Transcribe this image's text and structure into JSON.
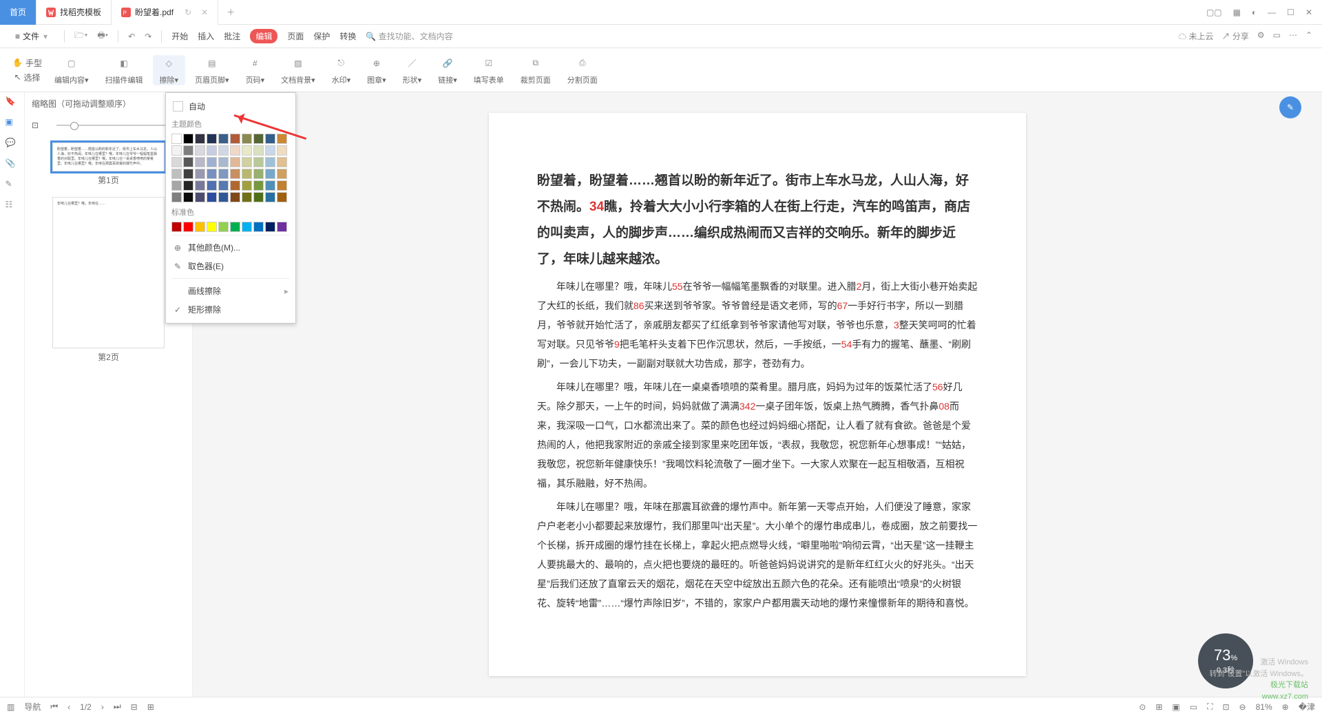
{
  "tabs": {
    "home": "首页",
    "t1": "找稻壳模板",
    "t2": "盼望着.pdf"
  },
  "file_label": "文件",
  "menu": {
    "start": "开始",
    "insert": "插入",
    "annotate": "批注",
    "edit": "编辑",
    "page": "页面",
    "protect": "保护",
    "convert": "转换",
    "search_ph": "查找功能、文档内容",
    "cloud": "未上云",
    "share": "分享"
  },
  "tools_left": {
    "hand": "手型",
    "select": "选择"
  },
  "ribbon": {
    "edit_content": "编辑内容",
    "scan": "扫描件编辑",
    "erase": "擦除",
    "header": "页眉页脚",
    "pagenum": "页码",
    "bg": "文档背景",
    "wm": "水印",
    "stamp": "图章",
    "shape": "形状",
    "link": "链接",
    "form": "填写表单",
    "crop": "裁剪页面",
    "split": "分割页面"
  },
  "side": {
    "title": "缩略图（可拖动调整顺序）",
    "p1": "第1页",
    "p2": "第2页"
  },
  "dropdown": {
    "auto": "自动",
    "theme": "主题颜色",
    "standard": "标准色",
    "more": "其他颜色(M)...",
    "picker": "取色器(E)",
    "line": "画线擦除",
    "rect": "矩形擦除"
  },
  "theme_row": [
    "#ffffff",
    "#000000",
    "#333344",
    "#223355",
    "#3a5f8a",
    "#b05c3a",
    "#8a8a50",
    "#556633",
    "#335f8a",
    "#cc8833"
  ],
  "grad_rows": [
    [
      "#f2f2f2",
      "#7f7f7f",
      "#d8d8e0",
      "#c6cde0",
      "#d0d8e6",
      "#f0d8c8",
      "#e8e8c8",
      "#d8e0c0",
      "#c8d8e8",
      "#f0dcc0"
    ],
    [
      "#d9d9d9",
      "#595959",
      "#b8b8c8",
      "#9fb0d0",
      "#a8b8d0",
      "#e0b898",
      "#d0d0a0",
      "#b8c898",
      "#a0c0d8",
      "#e0c090"
    ],
    [
      "#bfbfbf",
      "#404040",
      "#9898b0",
      "#7890c0",
      "#8098c0",
      "#c89060",
      "#b8b870",
      "#98b070",
      "#78a8c8",
      "#d0a060"
    ],
    [
      "#a6a6a6",
      "#262626",
      "#787898",
      "#5070b0",
      "#5878b0",
      "#b06830",
      "#a0a040",
      "#789840",
      "#5090b8",
      "#c08030"
    ],
    [
      "#7f7f7f",
      "#0d0d0d",
      "#4c4c70",
      "#2c4ca0",
      "#305898",
      "#804818",
      "#707018",
      "#507018",
      "#2870a0",
      "#a06010"
    ]
  ],
  "std_row": [
    "#c00000",
    "#ff0000",
    "#ffc000",
    "#ffff00",
    "#92d050",
    "#00b050",
    "#00b0f0",
    "#0070c0",
    "#002060",
    "#7030a0"
  ],
  "doc": {
    "h1_parts": [
      "盼望着，盼望着……翘首以盼的新年近了。街市上车水马龙，人山人海，好不热闹。",
      "34",
      "瞧，拎着大大小小行李箱的人在街上行走，汽车的鸣笛声，商店的叫卖声，人的脚步声……编织成热闹而又吉祥的交响乐。新年的脚步近了，年味儿越来越浓。"
    ],
    "p2": [
      "年味儿在哪里？哦，年味儿",
      "55",
      "在爷爷一幅幅笔墨飘香的对联里。进入腊",
      "2",
      "月，街上大街小巷开始卖起了大红的长纸，我们就",
      "86",
      "买来送到爷爷家。爷爷曾经是语文老师，写的",
      "67",
      "一手好行书字，所以一到腊月，爷爷就开始忙活了，亲戚朋友都买了红纸拿到爷爷家请他写对联，爷爷也乐意，",
      "3",
      "整天笑呵呵的忙着写对联。只见爷爷",
      "9",
      "把毛笔杆头支着下巴作沉思状，然后，一手按纸，一",
      "54",
      "手有力的握笔、蘸墨、“刷刷刷”，一会儿下功夫，一副副对联就大功告成，那字，苍劲有力。"
    ],
    "p3": [
      "年味儿在哪里？哦，年味儿在一桌桌香喷喷的菜肴里。腊月底，妈妈为过年的饭菜忙活了",
      "56",
      "好几天。除夕那天，一上午的时间，妈妈就做了满满",
      "342",
      "一桌子团年饭，饭桌上热气腾腾，香气扑鼻",
      "08",
      "而来，我深吸一口气，口水都流出来了。菜的颜色也经过妈妈细心搭配，让人看了就有食欲。爸爸是个爱热闹的人，他把我家附近的亲戚全接到家里来吃团年饭，“表叔，我敬您，祝您新年心想事成！”“姑姑，我敬您，祝您新年健康快乐！”我喝饮料轮流敬了一圈才坐下。一大家人欢聚在一起互相敬酒，互相祝福，其乐融融，好不热闹。"
    ],
    "p4": "年味儿在哪里？哦，年味在那震耳欲聋的爆竹声中。新年第一天零点开始，人们便没了睡意，家家户户老老小小都要起来放爆竹，我们那里叫“出天星”。大小单个的爆竹串成串儿，卷成圈，放之前要找一个长梯，拆开成圈的爆竹挂在长梯上，拿起火把点燃导火线，“噼里啪啦”响彻云霄，“出天星”这一挂鞭主人要挑最大的、最响的，点火把也要烧的最旺的。听爸爸妈妈说讲究的是新年红红火火的好兆头。“出天星”后我们还放了直窜云天的烟花，烟花在天空中绽放出五颜六色的花朵。还有能喷出“喷泉”的火树银花、旋转“地雷”……“爆竹声除旧岁”，不错的，家家户户都用震天动地的爆竹来憧憬新年的期待和喜悦。"
  },
  "status": {
    "nav": "导航",
    "pages": "1/2",
    "zoom": "81%"
  },
  "perf": {
    "pct": "73",
    "unit": "%",
    "sub": "0.3秒"
  },
  "activate": {
    "l1": "激活 Windows",
    "l2": "转到\"设置\"以激活 Windows。"
  },
  "wm": "极光下载站\nwww.xz7.com"
}
